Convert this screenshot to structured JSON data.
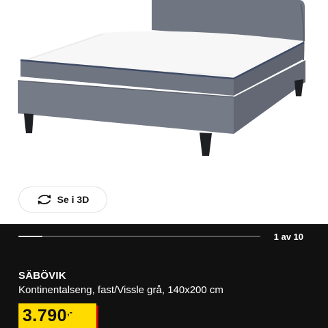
{
  "product": {
    "image_alt": "SÄBÖVIK Kontinentalseng, fast/Vissle grå, 140x200 cm",
    "name": "SÄBÖVIK",
    "description": "Kontinentalseng, fast/Vissle grå, 140x200 cm",
    "price": "3.790",
    "price_suffix": ",-"
  },
  "view3d": {
    "label": "Se i 3D",
    "icon": "rotate-3d-icon"
  },
  "gallery": {
    "counter": "1 av 10",
    "current": 1,
    "total": 10
  },
  "colors": {
    "panel": "#111111",
    "price_badge": "#ffdb00",
    "price_shadow": "#cc0008",
    "fabric": "#6d7280"
  }
}
